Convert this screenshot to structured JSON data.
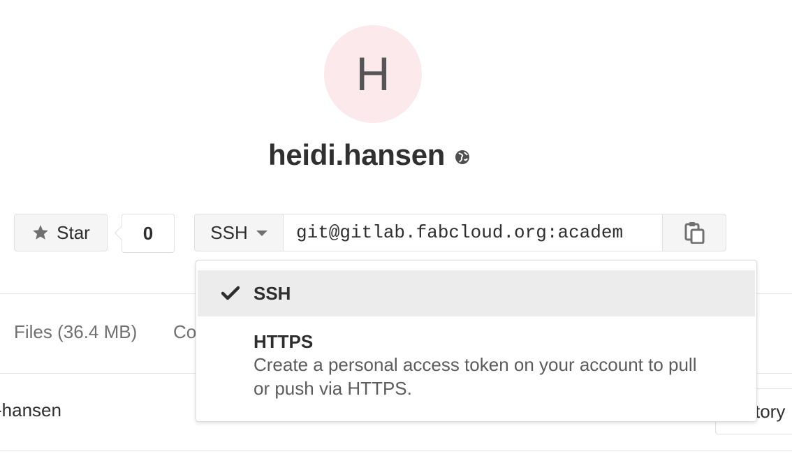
{
  "project": {
    "avatar_letter": "H",
    "name": "heidi.hansen"
  },
  "star": {
    "label": "Star",
    "count": "0"
  },
  "clone": {
    "protocol": "SSH",
    "url": "git@gitlab.fabcloud.org:academ"
  },
  "stats": {
    "files": "Files (36.4 MB)",
    "commits_partial": "Co"
  },
  "repo": {
    "path_partial": "-hansen",
    "right_button_partial": "tory"
  },
  "dropdown": {
    "items": [
      {
        "label": "SSH",
        "selected": true
      },
      {
        "label": "HTTPS",
        "description": "Create a personal access token on your account to pull or push via HTTPS."
      }
    ]
  },
  "icons": {
    "visibility": "globe-icon",
    "star": "star-icon",
    "caret": "caret-down-icon",
    "copy": "copy-icon",
    "check": "check-icon"
  },
  "colors": {
    "avatar_bg": "#fbe9eb",
    "dropdown_active_bg": "#ececec"
  }
}
